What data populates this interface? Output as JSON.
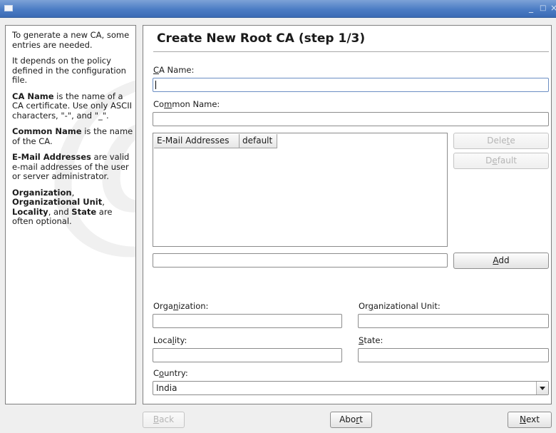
{
  "window": {
    "icon": "window-icon",
    "controls": {
      "minimize": "_",
      "maximize": "□",
      "close": "×"
    }
  },
  "help": {
    "p1": "To generate a new CA, some entries are needed.",
    "p2": "It depends on the policy defined in the configuration file.",
    "p3_bold": "CA Name",
    "p3_rest": " is the name of a CA certificate. Use only ASCII characters, \"-\", and \"_\".",
    "p4_bold": "Common Name",
    "p4_rest": " is the name of the CA.",
    "p5_bold": "E-Mail Addresses",
    "p5_rest": " are valid e-mail addresses of the user or server administrator.",
    "p6_bold1": "Organization",
    "p6_sep1": ", ",
    "p6_bold2": "Organizational Unit",
    "p6_sep2": ", ",
    "p6_bold3": "Locality",
    "p6_sep3": ", and ",
    "p6_bold4": "State",
    "p6_rest": " are often optional."
  },
  "main": {
    "title": "Create New Root CA (step 1/3)",
    "ca_name": {
      "label_u": "C",
      "label_rest": "A Name:",
      "value": ""
    },
    "common_name": {
      "label_pre": "Co",
      "label_u": "m",
      "label_rest": "mon Name:",
      "value": ""
    },
    "email_table": {
      "columns": [
        "E-Mail Addresses",
        "default"
      ],
      "rows": []
    },
    "delete_button": {
      "pre": "Dele",
      "u": "t",
      "post": "e"
    },
    "default_button": {
      "pre": "D",
      "u": "e",
      "post": "fault"
    },
    "email_input": "",
    "add_button": {
      "pre": "",
      "u": "A",
      "post": "dd"
    },
    "organization": {
      "label_pre": "Orga",
      "label_u": "n",
      "label_rest": "ization:",
      "value": ""
    },
    "org_unit": {
      "label_pre": "Or",
      "label_u": "g",
      "label_rest": "anizational Unit:",
      "value": ""
    },
    "locality": {
      "label_pre": "Loca",
      "label_u": "l",
      "label_rest": "ity:",
      "value": ""
    },
    "state": {
      "label_pre": "",
      "label_u": "S",
      "label_rest": "tate:",
      "value": ""
    },
    "country": {
      "label_pre": "C",
      "label_u": "o",
      "label_rest": "untry:",
      "value": "India"
    }
  },
  "footer": {
    "back": {
      "pre": "",
      "u": "B",
      "post": "ack"
    },
    "abort": {
      "pre": "Abo",
      "u": "r",
      "post": "t"
    },
    "next": {
      "pre": "",
      "u": "N",
      "post": "ext"
    }
  }
}
